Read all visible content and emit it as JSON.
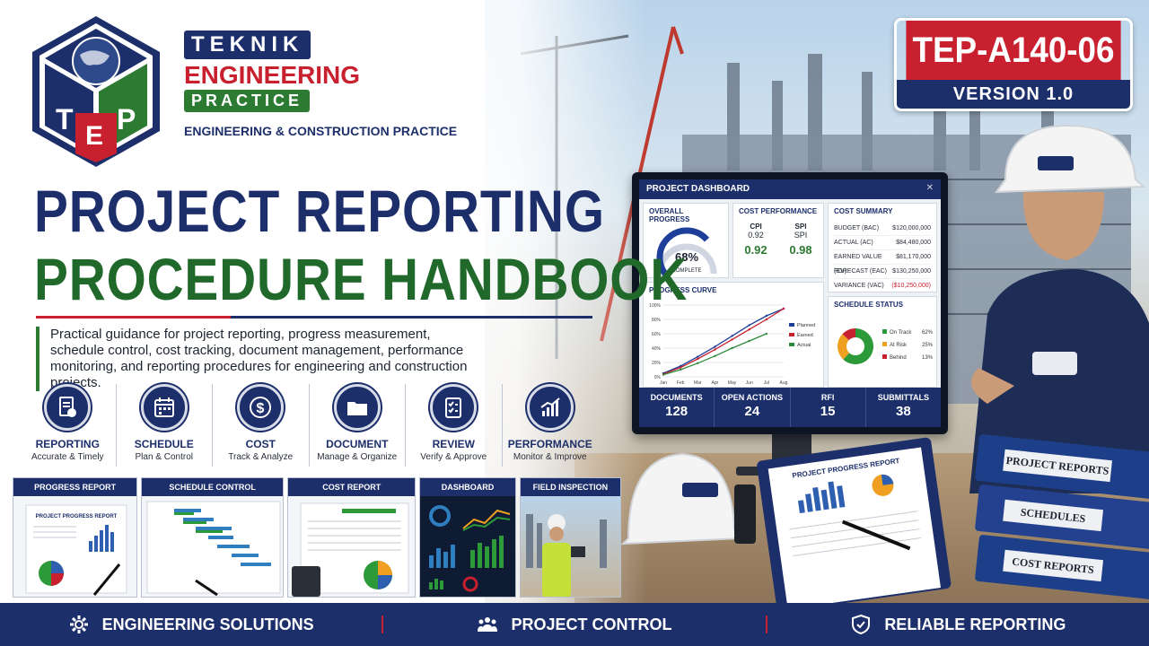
{
  "brand": {
    "line1": "TEKNIK",
    "line2": "ENGINEERING",
    "line3": "PRACTICE",
    "subtitle": "ENGINEERING & CONSTRUCTION PRACTICE",
    "logo_letters": "TEP"
  },
  "badge": {
    "code": "TEP-A140-06",
    "version": "VERSION 1.0"
  },
  "title": {
    "line1": "PROJECT REPORTING",
    "line2": "PROCEDURE HANDBOOK"
  },
  "description": "Practical guidance for project reporting, progress measurement, schedule control, cost tracking, document management, performance monitoring, and reporting procedures for engineering and construction projects.",
  "features": [
    {
      "title": "REPORTING",
      "subtitle": "Accurate & Timely",
      "icon": "report-icon"
    },
    {
      "title": "SCHEDULE",
      "subtitle": "Plan & Control",
      "icon": "calendar-icon"
    },
    {
      "title": "COST",
      "subtitle": "Track & Analyze",
      "icon": "dollar-icon"
    },
    {
      "title": "DOCUMENT",
      "subtitle": "Manage & Organize",
      "icon": "folder-icon"
    },
    {
      "title": "REVIEW",
      "subtitle": "Verify & Approve",
      "icon": "checklist-icon"
    },
    {
      "title": "PERFORMANCE",
      "subtitle": "Monitor & Improve",
      "icon": "trend-icon"
    }
  ],
  "thumbnails": [
    {
      "label": "PROGRESS REPORT",
      "doc_title": "PROJECT PROGRESS REPORT"
    },
    {
      "label": "SCHEDULE CONTROL"
    },
    {
      "label": "COST REPORT"
    },
    {
      "label": "DASHBOARD"
    },
    {
      "label": "FIELD INSPECTION REPORT"
    }
  ],
  "dashboard": {
    "title": "PROJECT DASHBOARD",
    "overall_progress": {
      "label": "OVERALL PROGRESS",
      "value": "68%",
      "caption": "COMPLETE",
      "fraction": 0.68
    },
    "cost_performance": {
      "label": "COST PERFORMANCE",
      "cpi_label": "CPI",
      "cpi_small": "0.92",
      "cpi": "0.92",
      "spi_label": "SPI",
      "spi_small": "SPI",
      "spi": "0.98"
    },
    "cost_summary": {
      "label": "COST SUMMARY",
      "rows": [
        {
          "k": "BUDGET (BAC)",
          "v": "$120,000,000"
        },
        {
          "k": "ACTUAL (AC)",
          "v": "$84,480,000"
        },
        {
          "k": "EARNED VALUE (EV)",
          "v": "$81,170,000"
        },
        {
          "k": "FORECAST (EAC)",
          "v": "$130,250,000"
        },
        {
          "k": "VARIANCE (VAC)",
          "v": "($10,250,000)"
        }
      ]
    },
    "progress_curve": {
      "label": "PROGRESS CURVE"
    },
    "schedule_status": {
      "label": "SCHEDULE STATUS",
      "items": [
        {
          "name": "On Track",
          "pct": "62%",
          "value": 62,
          "color": "#2d9a3a"
        },
        {
          "name": "At Risk",
          "pct": "25%",
          "value": 25,
          "color": "#f0a020"
        },
        {
          "name": "Behind",
          "pct": "13%",
          "value": 13,
          "color": "#c8202f"
        }
      ]
    },
    "kpis": [
      {
        "label": "DOCUMENTS",
        "value": "128"
      },
      {
        "label": "OPEN ACTIONS",
        "value": "24"
      },
      {
        "label": "RFI",
        "value": "15"
      },
      {
        "label": "SUBMITTALS",
        "value": "38"
      }
    ]
  },
  "chart_data": {
    "type": "line",
    "title": "PROGRESS CURVE",
    "categories": [
      "Jan",
      "Feb",
      "Mar",
      "Apr",
      "May",
      "Jun",
      "Jul",
      "Aug"
    ],
    "yticks": [
      "100%",
      "80%",
      "60%",
      "40%",
      "20%",
      "0%"
    ],
    "ylim": [
      0,
      100
    ],
    "series": [
      {
        "name": "Planned",
        "color": "#1d3f9a",
        "values": [
          5,
          15,
          28,
          42,
          57,
          72,
          85,
          95
        ]
      },
      {
        "name": "Earned",
        "color": "#c8202f",
        "values": [
          4,
          13,
          25,
          38,
          52,
          66,
          80,
          95
        ]
      },
      {
        "name": "Actual",
        "color": "#2d8a3a",
        "values": [
          3,
          10,
          19,
          29,
          40,
          50,
          60
        ]
      }
    ],
    "legend": "right"
  },
  "binders": [
    "PROJECT REPORTS",
    "SCHEDULES",
    "COST REPORTS"
  ],
  "clipboard": {
    "title": "PROJECT PROGRESS REPORT"
  },
  "footer": [
    {
      "label": "ENGINEERING SOLUTIONS",
      "icon": "gear-icon"
    },
    {
      "label": "PROJECT CONTROL",
      "icon": "team-icon"
    },
    {
      "label": "RELIABLE REPORTING",
      "icon": "shield-check-icon"
    }
  ],
  "colors": {
    "navy": "#1d2f6b",
    "red": "#c8202f",
    "green": "#2d7a32"
  }
}
